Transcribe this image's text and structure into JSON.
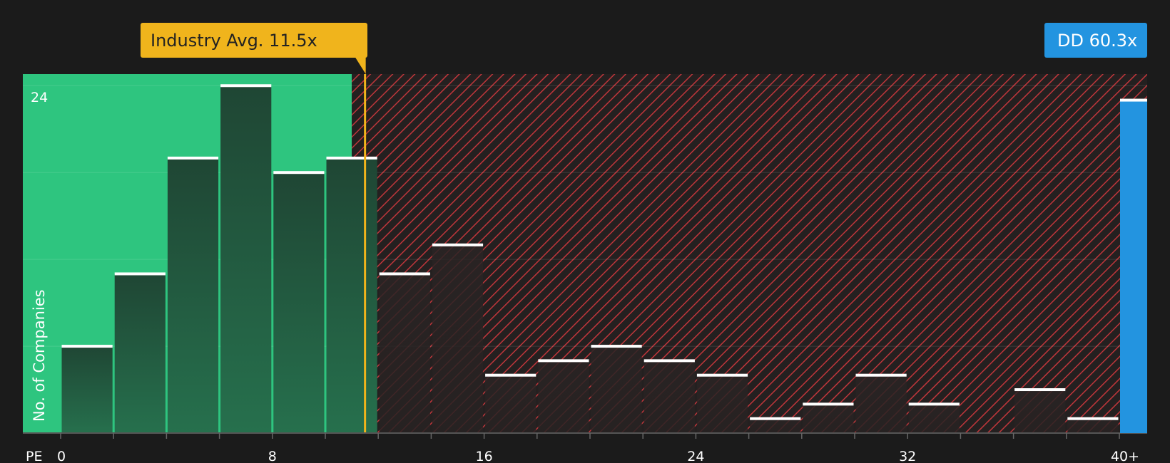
{
  "chart_data": {
    "type": "bar",
    "ylabel": "No. of Companies",
    "x_axis_prefix": "PE",
    "x_ticks": [
      "0",
      "8",
      "16",
      "24",
      "32",
      "40+"
    ],
    "y_ticks": [
      "24"
    ],
    "ylim": [
      0,
      24.8
    ],
    "xlim": [
      0,
      41
    ],
    "bin_width": 2,
    "bins": [
      {
        "start": 0,
        "value": 6
      },
      {
        "start": 2,
        "value": 11
      },
      {
        "start": 4,
        "value": 19
      },
      {
        "start": 6,
        "value": 24
      },
      {
        "start": 8,
        "value": 18
      },
      {
        "start": 10,
        "value": 19
      },
      {
        "start": 12,
        "value": 11
      },
      {
        "start": 14,
        "value": 13
      },
      {
        "start": 16,
        "value": 4
      },
      {
        "start": 18,
        "value": 5
      },
      {
        "start": 20,
        "value": 6
      },
      {
        "start": 22,
        "value": 5
      },
      {
        "start": 24,
        "value": 4
      },
      {
        "start": 26,
        "value": 1
      },
      {
        "start": 28,
        "value": 2
      },
      {
        "start": 30,
        "value": 4
      },
      {
        "start": 32,
        "value": 2
      },
      {
        "start": 34,
        "value": 0
      },
      {
        "start": 36,
        "value": 3
      },
      {
        "start": 38,
        "value": 1
      }
    ],
    "industry_avg": {
      "label": "Industry Avg. 11.5x",
      "value": 11.5
    },
    "company": {
      "label": "DD 60.3x",
      "value": 23
    },
    "fair_zone_end": 11,
    "grid": true,
    "colors": {
      "background": "#1b1b1b",
      "undervalued_zone": "#2ec57f",
      "overvalued_zone": "#d0363c",
      "industry_marker": "#f0b41c",
      "company_bar": "#2394e0",
      "bar_cap": "#ffffff"
    }
  }
}
